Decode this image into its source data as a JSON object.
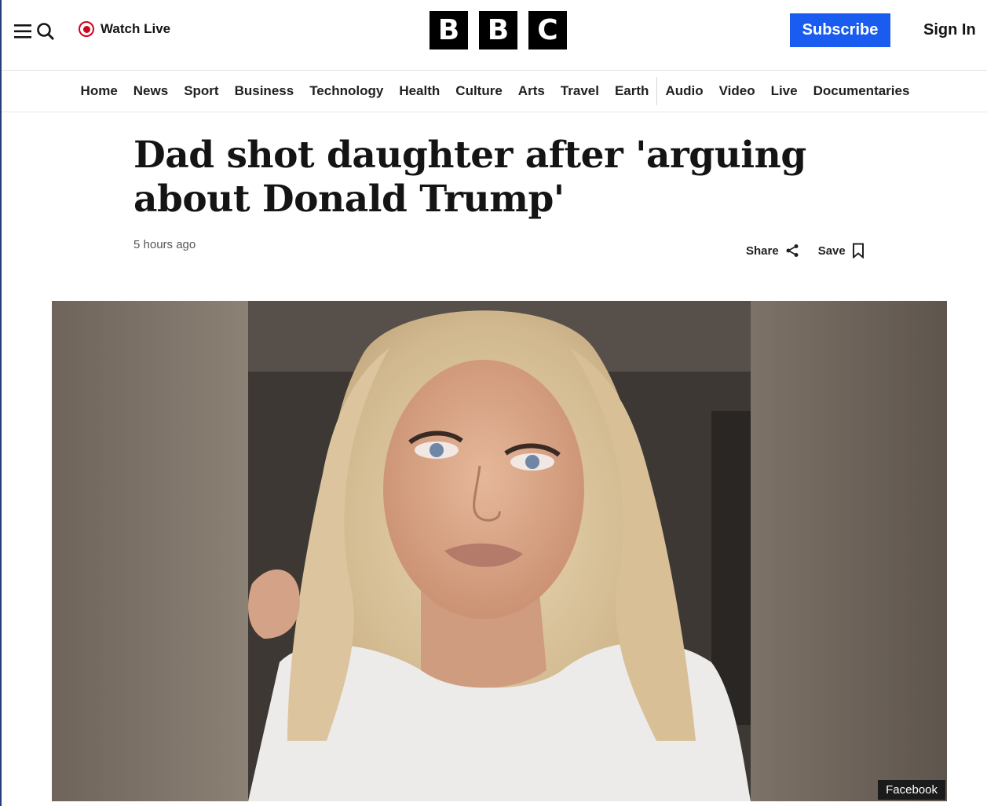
{
  "header": {
    "watch_live": "Watch Live",
    "logo_letters": [
      "B",
      "B",
      "C"
    ],
    "subscribe": "Subscribe",
    "sign_in": "Sign In"
  },
  "nav": {
    "items": [
      "Home",
      "News",
      "Sport",
      "Business",
      "Technology",
      "Health",
      "Culture",
      "Arts",
      "Travel",
      "Earth",
      "Audio",
      "Video",
      "Live",
      "Documentaries"
    ]
  },
  "article": {
    "headline": "Dad shot daughter after 'arguing about Donald Trump'",
    "timestamp": "5 hours ago",
    "share_label": "Share",
    "save_label": "Save",
    "image_credit": "Facebook"
  },
  "colors": {
    "subscribe_bg": "#1a5cf0",
    "live_red": "#d0021b",
    "logo_block": "#000000"
  },
  "icons": {
    "menu": "menu-icon",
    "search": "search-icon",
    "live": "live-dot-icon",
    "share": "share-icon",
    "save": "bookmark-icon"
  }
}
